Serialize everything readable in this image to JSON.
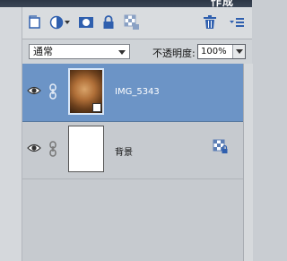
{
  "window": {
    "title": "作成"
  },
  "toolbar": {
    "icons": [
      "new-layer-icon",
      "adjustment-layer-icon",
      "layer-mask-icon",
      "lock-icon",
      "lock-transparency-icon",
      "trash-icon",
      "panel-menu-icon"
    ],
    "accent": "#2f5fae"
  },
  "options": {
    "blend_mode": "通常",
    "opacity_label": "不透明度:",
    "opacity_value": "100%"
  },
  "layers": [
    {
      "name": "IMG_5343",
      "selected": true,
      "visible": true,
      "locked": false
    },
    {
      "name": "背景",
      "selected": false,
      "visible": true,
      "locked": true
    }
  ],
  "colors": {
    "selected_row": "#6c94c6",
    "panel_bg": "#c6cacf"
  }
}
